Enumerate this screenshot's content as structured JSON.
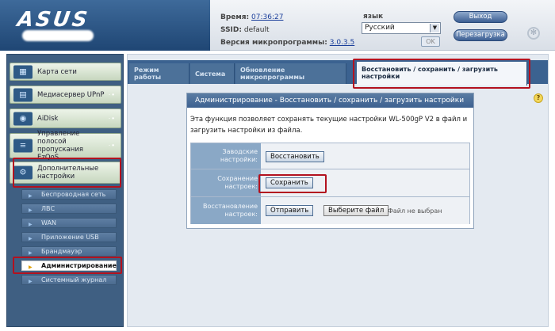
{
  "header": {
    "brand": "ASUS",
    "time_label": "Время:",
    "time_value": "07:36:27",
    "ssid_label": "SSID:",
    "ssid_value": "default",
    "firmware_label": "Версия микропрограммы:",
    "firmware_value": "3.0.3.5",
    "language_label": "язык",
    "language_value": "Русский",
    "ok_label": "OK",
    "logout_label": "Выход",
    "reboot_label": "Перезагрузка"
  },
  "sidebar": {
    "main_items": [
      {
        "label": "Карта сети",
        "icon": "network-map-icon"
      },
      {
        "label": "Медиасервер UPnP",
        "icon": "media-server-icon"
      },
      {
        "label": "AiDisk",
        "icon": "aidisk-icon"
      },
      {
        "label": "Управление полосой пропускания EzQoS",
        "icon": "qos-icon"
      },
      {
        "label": "Дополнительные настройки",
        "icon": "advanced-settings-icon"
      }
    ],
    "sub_items": [
      {
        "label": "Беспроводная сеть"
      },
      {
        "label": "ЛВС"
      },
      {
        "label": "WAN"
      },
      {
        "label": "Приложение USB"
      },
      {
        "label": "Брандмауэр"
      },
      {
        "label": "Администрирование",
        "active": true
      },
      {
        "label": "Системный журнал"
      }
    ]
  },
  "tabs": [
    {
      "label": "Режим работы"
    },
    {
      "label": "Система"
    },
    {
      "label": "Обновление микропрограммы"
    },
    {
      "label": "Восстановить / сохранить / загрузить настройки",
      "active": true
    }
  ],
  "panel": {
    "title": "Администрирование - Восстановить / сохранить / загрузить настройки",
    "description": "Эта функция позволяет сохранять текущие настройки WL-500gP V2 в файл и загрузить настройки из файла.",
    "rows": [
      {
        "label": "Заводские настройки:",
        "button": "Восстановить"
      },
      {
        "label": "Сохранение настроек:",
        "button": "Сохранить"
      },
      {
        "label": "Восстановление настроек:",
        "button": "Отправить",
        "file_button": "Выберите файл",
        "file_status": "Файл не выбран"
      }
    ]
  },
  "colors": {
    "highlight": "#b3121f",
    "tab_bar": "#3b6290",
    "panel_title": "#3d6190"
  }
}
